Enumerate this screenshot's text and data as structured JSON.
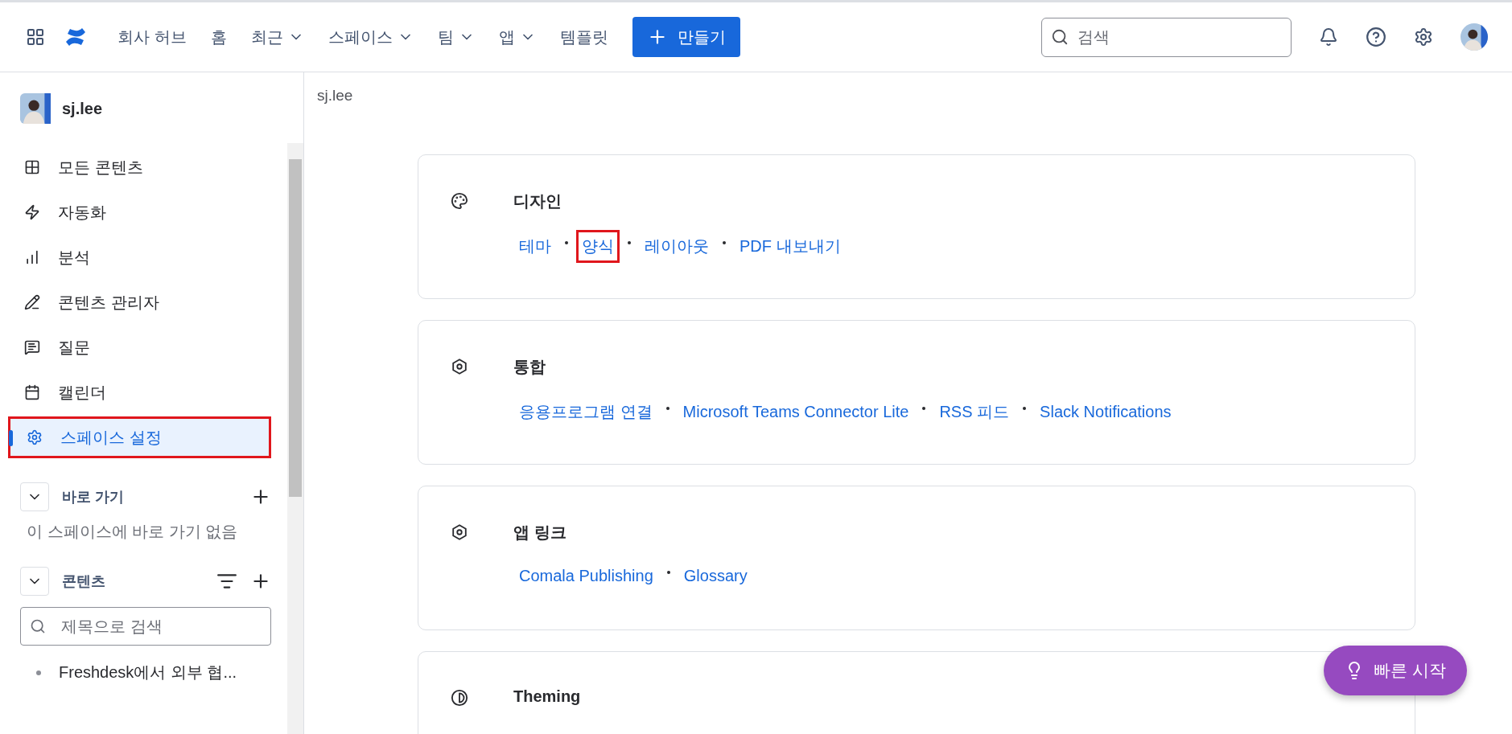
{
  "topnav": {
    "items": [
      {
        "label": "회사 허브",
        "dropdown": false
      },
      {
        "label": "홈",
        "dropdown": false
      },
      {
        "label": "최근",
        "dropdown": true
      },
      {
        "label": "스페이스",
        "dropdown": true
      },
      {
        "label": "팀",
        "dropdown": true
      },
      {
        "label": "앱",
        "dropdown": true
      },
      {
        "label": "템플릿",
        "dropdown": false
      }
    ],
    "create_button": "만들기",
    "search": {
      "placeholder": "검색"
    }
  },
  "sidebar": {
    "space_name": "sj.lee",
    "items": [
      {
        "label": "모든 콘텐츠",
        "selected": false,
        "annotated": false
      },
      {
        "label": "자동화",
        "selected": false,
        "annotated": false
      },
      {
        "label": "분석",
        "selected": false,
        "annotated": false
      },
      {
        "label": "콘텐츠 관리자",
        "selected": false,
        "annotated": false
      },
      {
        "label": "질문",
        "selected": false,
        "annotated": false
      },
      {
        "label": "캘린더",
        "selected": false,
        "annotated": false
      },
      {
        "label": "스페이스 설정",
        "selected": true,
        "annotated": true
      }
    ],
    "shortcuts": {
      "title": "바로 가기",
      "empty_text": "이 스페이스에 바로 가기 없음"
    },
    "content": {
      "title": "콘텐츠",
      "search": {
        "placeholder": "제목으로 검색"
      },
      "items": [
        {
          "label": "Freshdesk에서 외부 협..."
        }
      ]
    }
  },
  "breadcrumb": "sj.lee",
  "sections": [
    {
      "title": "디자인",
      "links": [
        {
          "label": "테마",
          "annotated": false
        },
        {
          "label": "양식",
          "annotated": true
        },
        {
          "label": "레이아웃",
          "annotated": false
        },
        {
          "label": "PDF 내보내기",
          "annotated": false
        }
      ]
    },
    {
      "title": "통합",
      "links": [
        {
          "label": "응용프로그램 연결",
          "annotated": false
        },
        {
          "label": "Microsoft Teams Connector Lite",
          "annotated": false
        },
        {
          "label": "RSS 피드",
          "annotated": false
        },
        {
          "label": "Slack Notifications",
          "annotated": false
        }
      ]
    },
    {
      "title": "앱 링크",
      "links": [
        {
          "label": "Comala Publishing",
          "annotated": false
        },
        {
          "label": "Glossary",
          "annotated": false
        }
      ]
    },
    {
      "title": "Theming"
    }
  ],
  "quick_start": "빠른 시작"
}
